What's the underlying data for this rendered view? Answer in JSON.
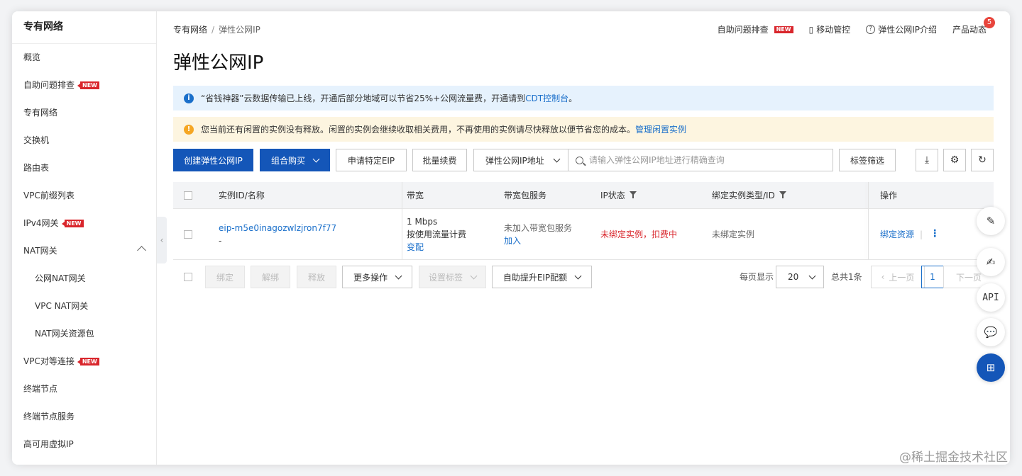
{
  "sidebar": {
    "title": "专有网络",
    "items": [
      {
        "label": "概览",
        "new": false
      },
      {
        "label": "自助问题排查",
        "new": true
      },
      {
        "label": "专有网络",
        "new": false
      },
      {
        "label": "交换机",
        "new": false
      },
      {
        "label": "路由表",
        "new": false
      },
      {
        "label": "VPC前缀列表",
        "new": false
      },
      {
        "label": "IPv4网关",
        "new": true
      },
      {
        "label": "NAT网关",
        "new": false
      },
      {
        "label": "公网NAT网关",
        "new": false
      },
      {
        "label": "VPC NAT网关",
        "new": false
      },
      {
        "label": "NAT网关资源包",
        "new": false
      },
      {
        "label": "VPC对等连接",
        "new": true
      },
      {
        "label": "终端节点",
        "new": false
      },
      {
        "label": "终端节点服务",
        "new": false
      },
      {
        "label": "高可用虚拟IP",
        "new": false
      }
    ],
    "new_badge": "NEW"
  },
  "header": {
    "breadcrumb": [
      "专有网络",
      "弹性公网IP"
    ],
    "breadcrumb_sep": "/",
    "links": {
      "troubleshoot": "自助问题排查",
      "mobile": "移动管控",
      "intro": "弹性公网IP介绍",
      "news": "产品动态",
      "news_count": "5"
    },
    "title": "弹性公网IP"
  },
  "alerts": {
    "info_text": "“省钱神器”云数据传输已上线，开通后部分地域可以节省25%+公网流量费，开通请到",
    "info_link": "CDT控制台",
    "info_tail": "。",
    "warn_text": "您当前还有闲置的实例没有释放。闲置的实例会继续收取相关费用，不再使用的实例请尽快释放以便节省您的成本。",
    "warn_link": "管理闲置实例"
  },
  "toolbar": {
    "create": "创建弹性公网IP",
    "combo": "组合购买",
    "apply": "申请特定EIP",
    "renew": "批量续费",
    "search_select": "弹性公网IP地址",
    "search_placeholder": "请输入弹性公网IP地址进行精确查询",
    "tag_filter": "标签筛选"
  },
  "table": {
    "headers": {
      "id": "实例ID/名称",
      "bandwidth": "带宽",
      "package": "带宽包服务",
      "status": "IP状态",
      "bind_type": "绑定实例类型/ID",
      "ops": "操作"
    },
    "rows": [
      {
        "id": "eip-m5e0inagozwlzjron7f77",
        "name": "-",
        "bandwidth": "1 Mbps",
        "billing": "按使用流量计费",
        "change": "变配",
        "package": "未加入带宽包服务",
        "join": "加入",
        "status": "未绑定实例，扣费中",
        "bind": "未绑定实例",
        "op_bind": "绑定资源"
      }
    ]
  },
  "bottom": {
    "bind": "绑定",
    "unbind": "解绑",
    "release": "释放",
    "more": "更多操作",
    "set_tag": "设置标签",
    "quota": "自助提升EIP配额",
    "per_page_label": "每页显示",
    "per_page": "20",
    "total": "总共1条",
    "prev": "上一页",
    "page": "1",
    "next": "下一页"
  },
  "floating": {
    "api": "API"
  },
  "watermark": "@稀土掘金技术社区",
  "colors": {
    "primary": "#1456b8",
    "link": "#1a6fca",
    "danger": "#d9262c",
    "info_bg": "#e6f2fd",
    "warn_bg": "#fdf5e0"
  }
}
